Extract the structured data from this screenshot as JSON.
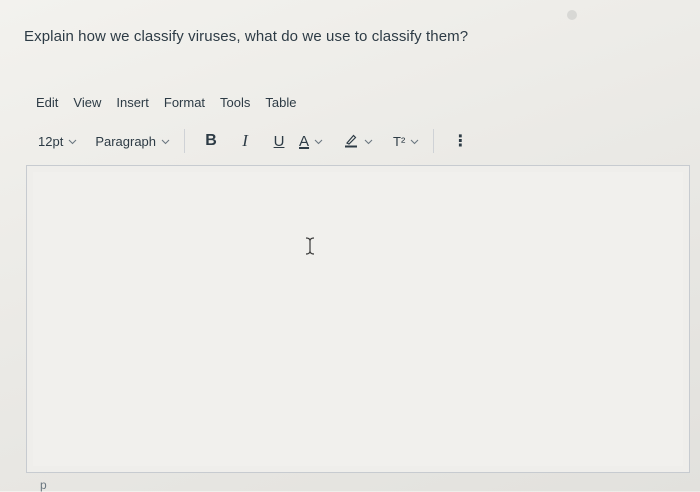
{
  "question": "Explain how we classify viruses, what do we use to classify them?",
  "menu": [
    "Edit",
    "View",
    "Insert",
    "Format",
    "Tools",
    "Table"
  ],
  "toolbar": {
    "font_size": "12pt",
    "block_format": "Paragraph",
    "bold_label": "B",
    "italic_label": "I",
    "underline_label": "U",
    "font_color_label": "A",
    "superscript_label": "T²",
    "more_label": "⋮"
  },
  "editor": {
    "content": ""
  },
  "status_bar": {
    "path": "p"
  },
  "colors": {
    "text": "#2d3b45",
    "border": "#c7cbd0",
    "background": "#efeeeb"
  },
  "icons": [
    "chevron-down-icon",
    "highlight-icon",
    "text-cursor-icon",
    "more-options-icon"
  ]
}
